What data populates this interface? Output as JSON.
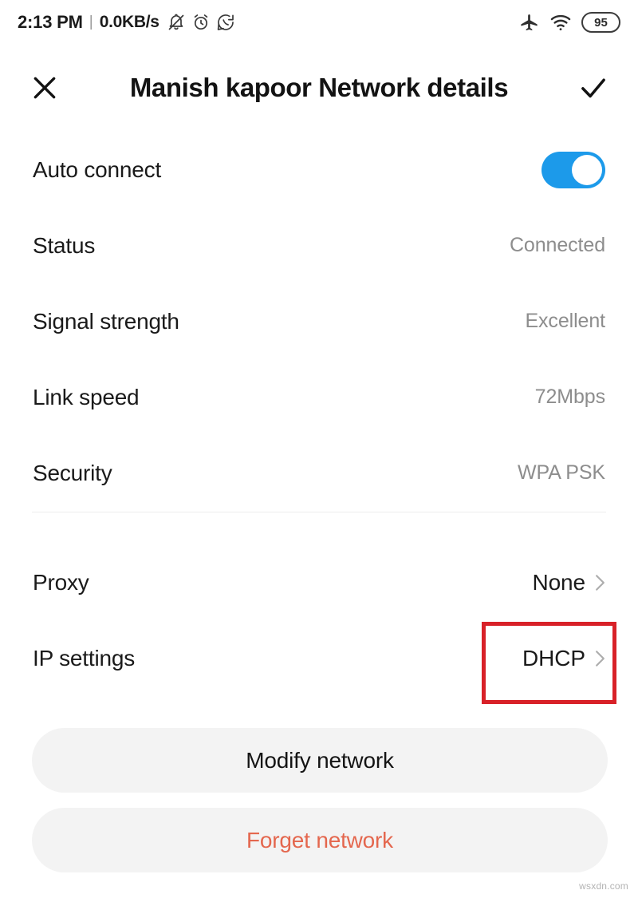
{
  "status_bar": {
    "time": "2:13 PM",
    "separator": "|",
    "network_speed": "0.0KB/s",
    "left_icons": [
      "notifications-silenced-icon",
      "alarm-clock-icon",
      "whatsapp-icon"
    ],
    "right_icons": [
      "airplane-mode-icon",
      "wifi-icon"
    ],
    "battery_level": "95"
  },
  "header": {
    "close_icon": "close-icon",
    "title": "Manish kapoor Network details",
    "confirm_icon": "check-icon"
  },
  "details": {
    "auto_connect": {
      "label": "Auto connect",
      "toggle_on": true,
      "accent_color": "#1c9aea"
    },
    "rows": [
      {
        "label": "Status",
        "value": "Connected"
      },
      {
        "label": "Signal strength",
        "value": "Excellent"
      },
      {
        "label": "Link speed",
        "value": "72Mbps"
      },
      {
        "label": "Security",
        "value": "WPA PSK"
      }
    ]
  },
  "network_config": {
    "rows": [
      {
        "label": "Proxy",
        "value": "None",
        "chevron": "chevron-right-icon"
      },
      {
        "label": "IP settings",
        "value": "DHCP",
        "chevron": "chevron-right-icon"
      }
    ]
  },
  "annotation": {
    "target": "ip-settings-value",
    "color": "#d82128"
  },
  "actions": {
    "modify": "Modify network",
    "forget": "Forget network",
    "forget_color": "#e4674e"
  },
  "watermark": "wsxdn.com"
}
